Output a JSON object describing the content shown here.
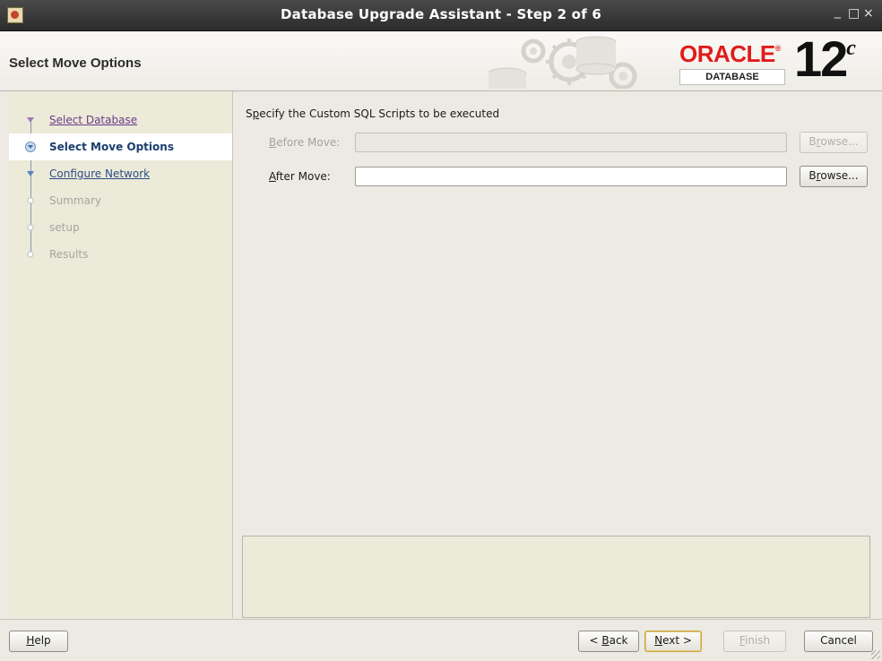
{
  "window": {
    "title": "Database Upgrade Assistant - Step 2 of 6",
    "controls": {
      "minimize": "_",
      "maximize": "□",
      "close": "×"
    }
  },
  "header": {
    "title": "Select Move Options",
    "logo": {
      "brand": "ORACLE",
      "trademark": "®",
      "product": "DATABASE",
      "version": "12",
      "version_suffix": "c"
    }
  },
  "steps": [
    {
      "label": "Select Database",
      "state": "done"
    },
    {
      "label": "Select Move Options",
      "state": "active"
    },
    {
      "label": "Configure Network",
      "state": "link"
    },
    {
      "label": "Summary",
      "state": "pending"
    },
    {
      "label": "setup",
      "state": "pending"
    },
    {
      "label": "Results",
      "state": "pending"
    }
  ],
  "main": {
    "section_label_prefix": "S",
    "section_label_mnemonic": "p",
    "section_label_rest": "ecify the Custom SQL Scripts to be executed",
    "before_move": {
      "label_mnemonic": "B",
      "label_rest": "efore Move:",
      "value": "",
      "enabled": false,
      "browse_prefix": "B",
      "browse_mnemonic": "r",
      "browse_rest": "owse..."
    },
    "after_move": {
      "label_mnemonic": "A",
      "label_rest": "fter Move:",
      "value": "",
      "enabled": true,
      "browse_prefix": "B",
      "browse_mnemonic": "r",
      "browse_rest": "owse..."
    },
    "message_panel_text": ""
  },
  "footer": {
    "help": {
      "mnemonic": "H",
      "rest": "elp"
    },
    "back": {
      "prefix": "< ",
      "mnemonic": "B",
      "rest": "ack"
    },
    "next": {
      "mnemonic": "N",
      "rest": "ext >"
    },
    "finish": {
      "mnemonic": "F",
      "rest": "inish"
    },
    "cancel": {
      "label": "Cancel"
    }
  },
  "colors": {
    "title_bar": "#2b2b2b",
    "oracle_red": "#e01b1b",
    "sidebar_bg": "#ecead8",
    "active_step_text": "#1b3d6e",
    "visited_link": "#6a3a8a",
    "next_link": "#2e4d86",
    "pending_text": "#a5a5a0",
    "focus_border": "#c9a441"
  }
}
